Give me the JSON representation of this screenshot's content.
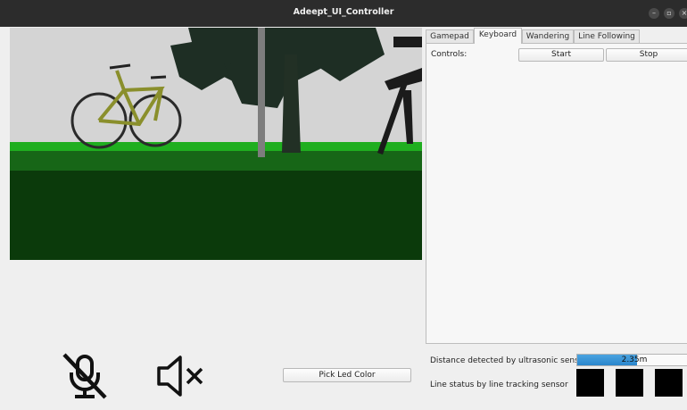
{
  "window": {
    "title": "Adeept_UI_Controller"
  },
  "tabs": [
    {
      "label": "Gamepad",
      "active": false
    },
    {
      "label": "Keyboard",
      "active": true
    },
    {
      "label": "Wandering",
      "active": false
    },
    {
      "label": "Line Following",
      "active": false
    }
  ],
  "keyboard_panel": {
    "controls_label": "Controls:",
    "start_label": "Start",
    "stop_label": "Stop"
  },
  "controls": {
    "mic_icon": "microphone-muted-icon",
    "speaker_icon": "speaker-muted-icon",
    "pick_led_label": "Pick Led Color"
  },
  "sensors": {
    "distance_label": "Distance detected by ultrasonic sensor:",
    "distance_value": "2.35m",
    "distance_fraction": 0.52,
    "line_label": "Line status by line tracking sensor",
    "line_indicators": [
      "#000000",
      "#000000",
      "#000000"
    ]
  },
  "colors": {
    "titlebar": "#2c2c2c",
    "progress_fill": "#2f8fd6",
    "ground": "#0f4a0f",
    "grass_strip": "#1fb31f"
  }
}
